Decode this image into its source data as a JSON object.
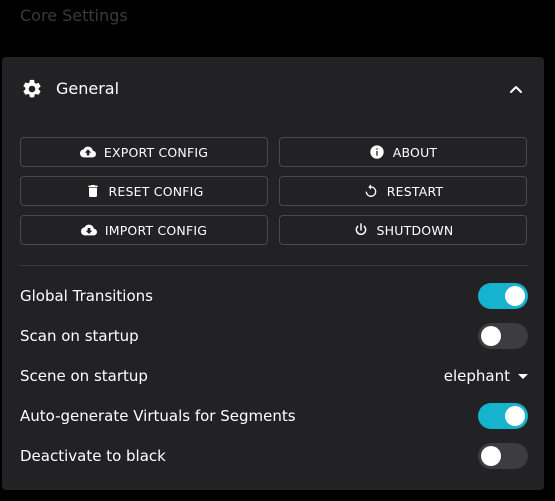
{
  "page": {
    "title": "Core Settings"
  },
  "card": {
    "title": "General",
    "buttons": {
      "export": "EXPORT CONFIG",
      "about": "ABOUT",
      "reset": "RESET CONFIG",
      "restart": "RESTART",
      "import": "IMPORT CONFIG",
      "shutdown": "SHUTDOWN"
    },
    "settings": {
      "global_transitions": {
        "label": "Global Transitions",
        "enabled": true
      },
      "scan_on_startup": {
        "label": "Scan on startup",
        "enabled": false
      },
      "scene_on_startup": {
        "label": "Scene on startup",
        "value": "elephant"
      },
      "auto_generate": {
        "label": "Auto-generate Virtuals for Segments",
        "enabled": true
      },
      "deactivate": {
        "label": "Deactivate to black",
        "enabled": false
      }
    }
  },
  "colors": {
    "toggle_on": "#16b3cf",
    "toggle_off": "#3d3d40",
    "card_bg": "#222224"
  },
  "icons": {
    "header": "gear-icon",
    "collapse": "chevron-up-icon",
    "export": "cloud-upload-icon",
    "about": "info-icon",
    "reset": "trash-icon",
    "restart": "restart-icon",
    "import": "cloud-download-icon",
    "shutdown": "power-icon"
  }
}
